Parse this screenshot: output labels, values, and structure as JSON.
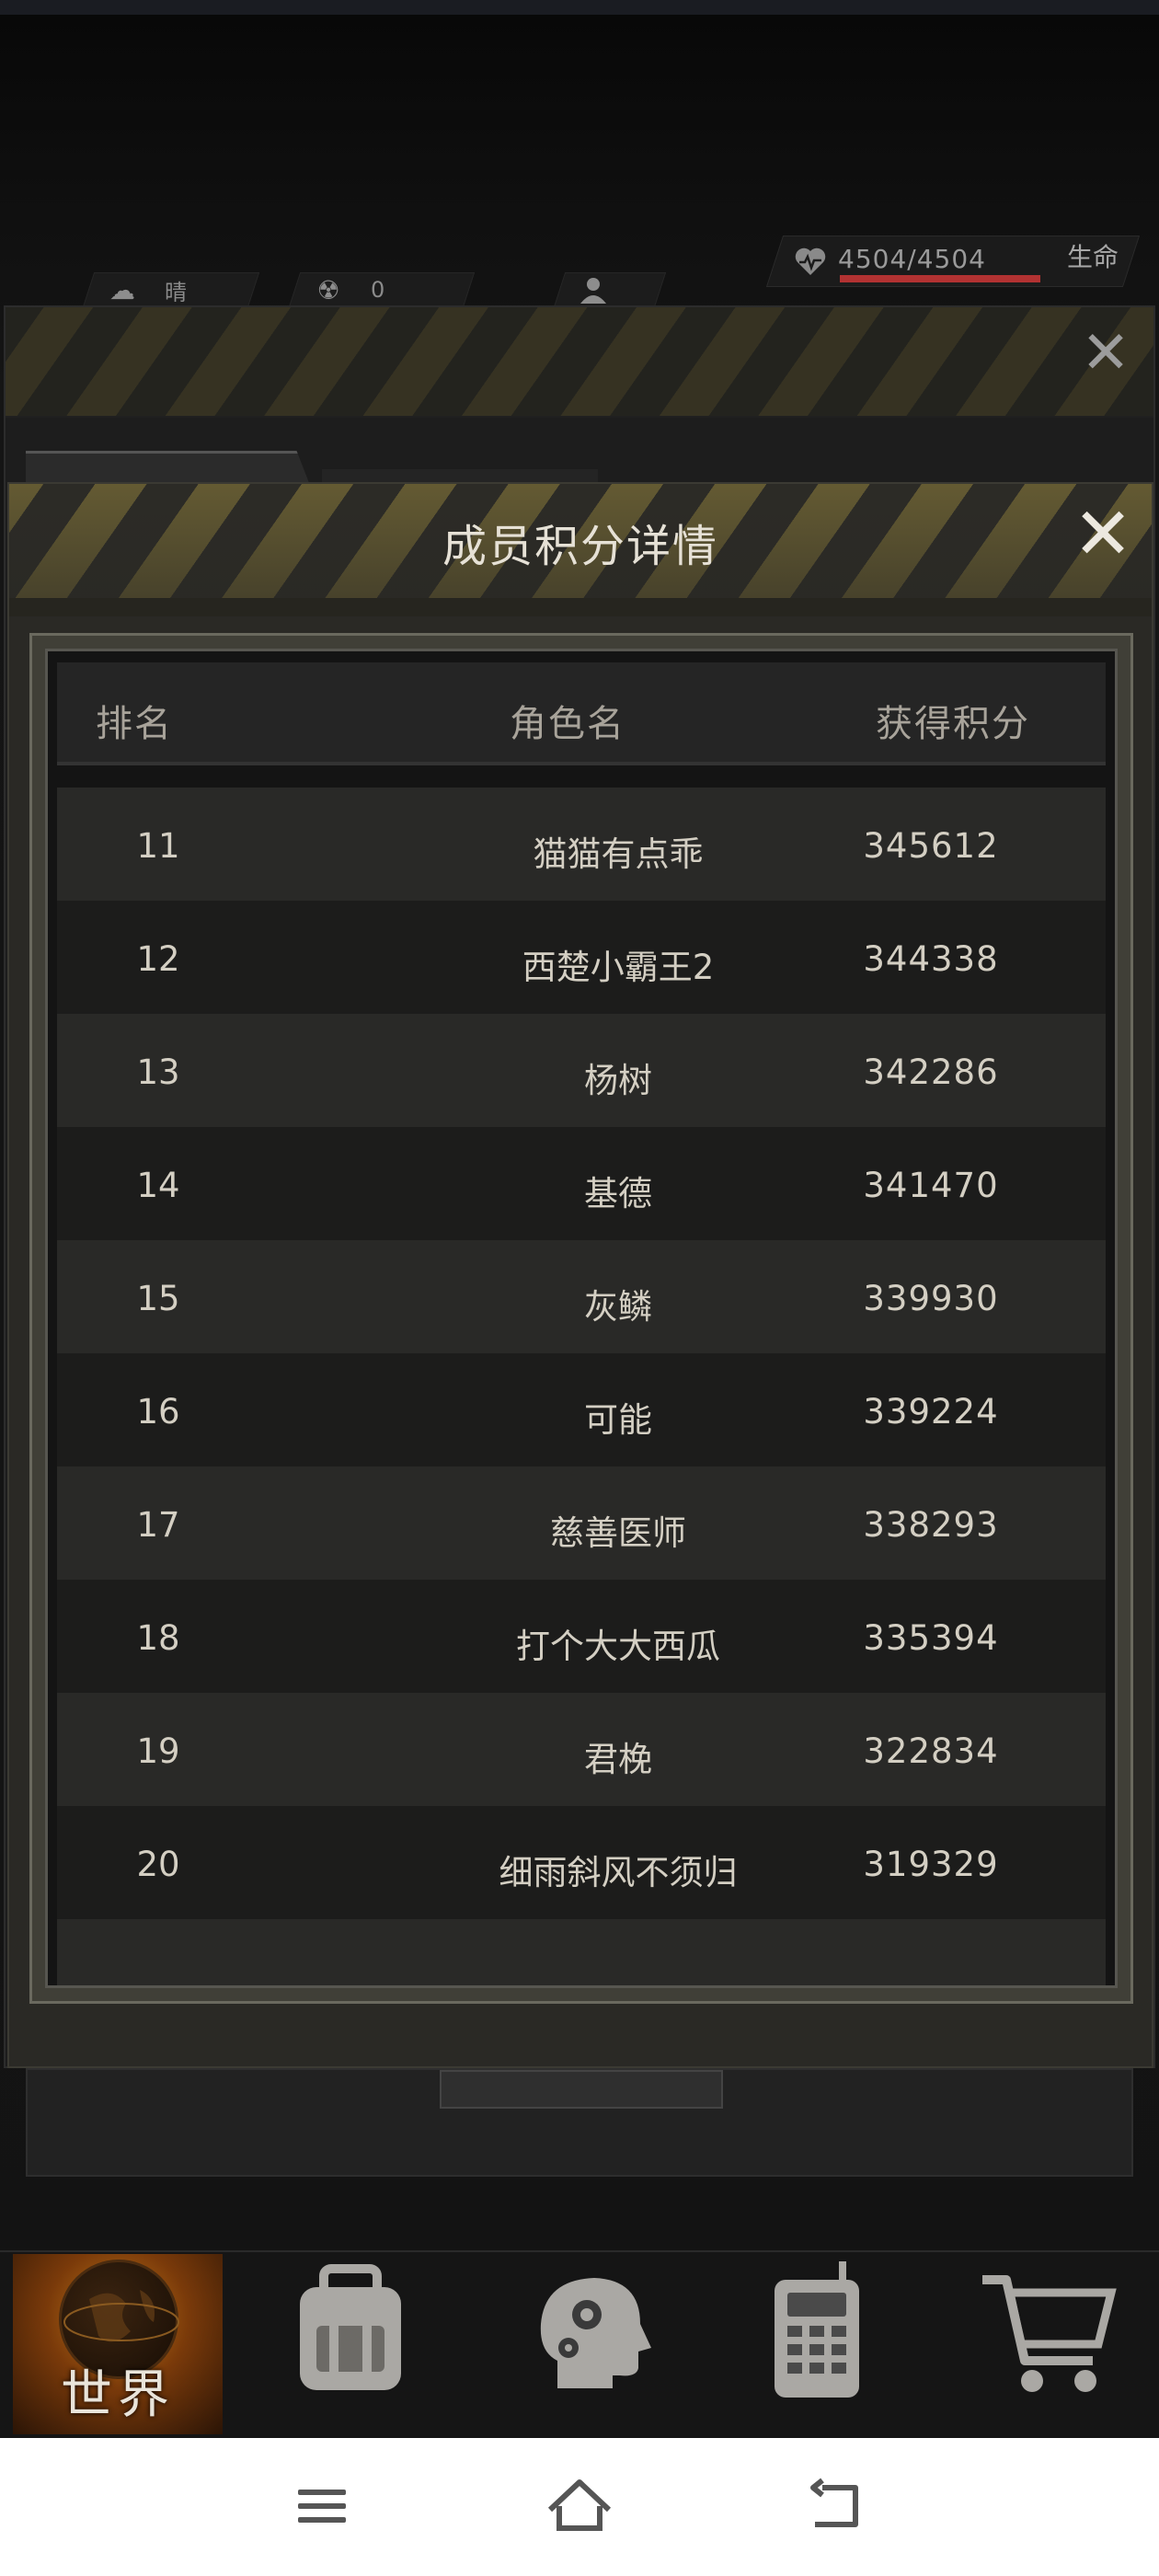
{
  "hud": {
    "weather": "晴",
    "radiation": "0",
    "hp_text": "4504/4504",
    "hp_fraction": 1.0,
    "hp_label": "生命"
  },
  "dialog": {
    "title": "成员积分详情",
    "headers": {
      "rank": "排名",
      "name": "角色名",
      "score": "获得积分"
    },
    "rows": [
      {
        "rank": "11",
        "name": "猫猫有点乖",
        "score": "345612"
      },
      {
        "rank": "12",
        "name": "西楚小霸王2",
        "score": "344338"
      },
      {
        "rank": "13",
        "name": "杨树",
        "score": "342286"
      },
      {
        "rank": "14",
        "name": "基德",
        "score": "341470"
      },
      {
        "rank": "15",
        "name": "灰鳞",
        "score": "339930"
      },
      {
        "rank": "16",
        "name": "可能",
        "score": "339224"
      },
      {
        "rank": "17",
        "name": "慈善医师",
        "score": "338293"
      },
      {
        "rank": "18",
        "name": "打个大大西瓜",
        "score": "335394"
      },
      {
        "rank": "19",
        "name": "君梚",
        "score": "322834"
      },
      {
        "rank": "20",
        "name": "细雨斜风不须归",
        "score": "319329"
      }
    ]
  },
  "nav": {
    "world_label": "世界",
    "icons": [
      "backpack-icon",
      "brain-gear-icon",
      "radio-icon",
      "shopping-cart-icon"
    ]
  },
  "colors": {
    "accent_stripe": "#6e6335",
    "hp_bar": "#b23232",
    "world_tab": "#c47a18"
  }
}
